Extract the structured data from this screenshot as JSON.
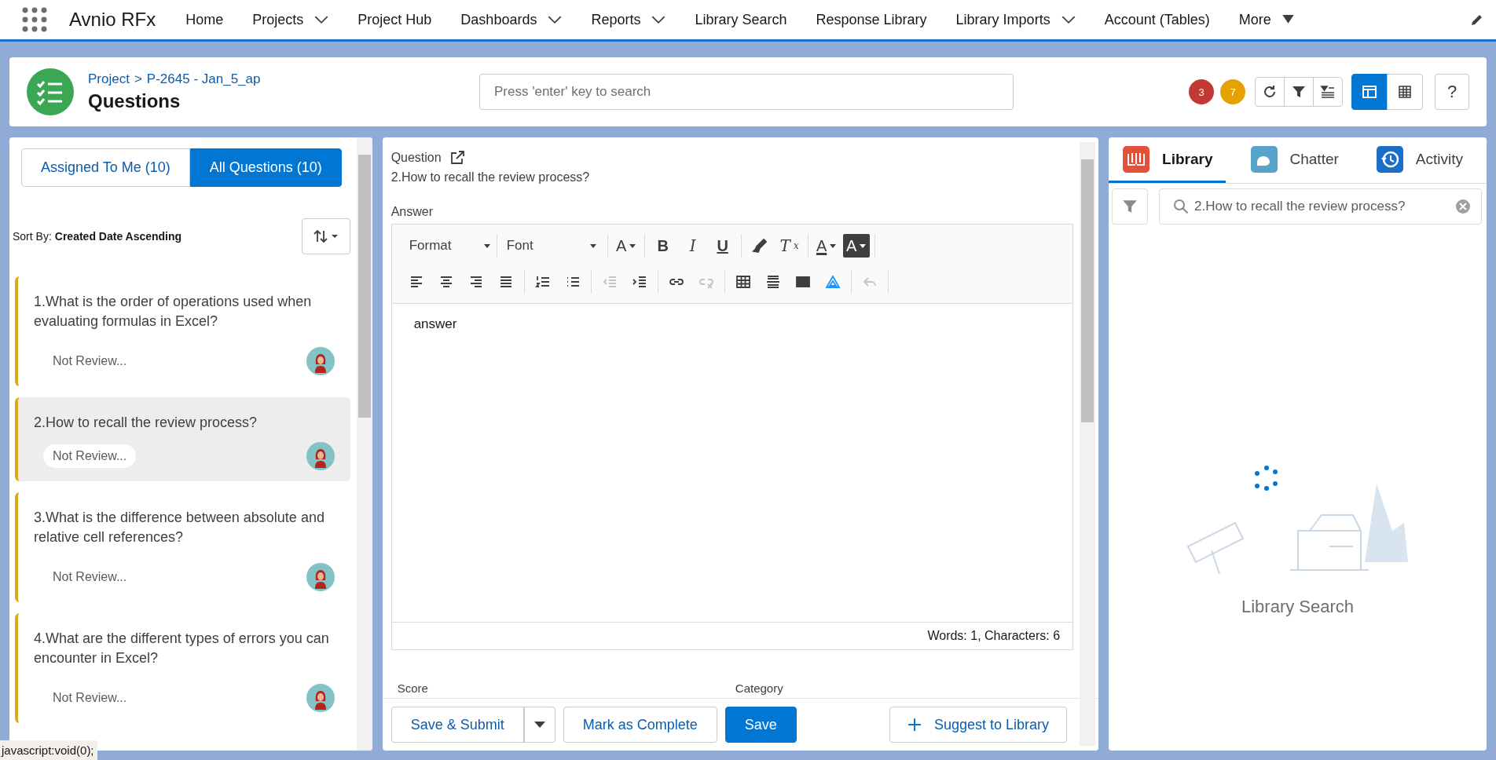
{
  "nav": {
    "app_name": "Avnio RFx",
    "items": [
      {
        "label": "Home",
        "kind": "link"
      },
      {
        "label": "Projects",
        "kind": "chevron-menu"
      },
      {
        "label": "Project Hub",
        "kind": "link"
      },
      {
        "label": "Dashboards",
        "kind": "chevron-menu"
      },
      {
        "label": "Reports",
        "kind": "chevron-menu"
      },
      {
        "label": "Library Search",
        "kind": "link"
      },
      {
        "label": "Response Library",
        "kind": "link"
      },
      {
        "label": "Library Imports",
        "kind": "chevron-menu"
      },
      {
        "label": "Account (Tables)",
        "kind": "link"
      },
      {
        "label": "More",
        "kind": "triangle-menu"
      }
    ]
  },
  "header": {
    "breadcrumb": [
      "Project",
      ">",
      "P-2645 - Jan_5_ap"
    ],
    "title": "Questions",
    "search": {
      "placeholder": "Press 'enter' key to search"
    },
    "badges": [
      {
        "count": "3",
        "color": "#c23934"
      },
      {
        "count": "7",
        "color": "#e4a201"
      }
    ],
    "views": [
      {
        "kind": "cards",
        "selected": true
      },
      {
        "kind": "table",
        "selected": false
      }
    ],
    "help": "?"
  },
  "left": {
    "tabs": [
      {
        "label": "Assigned To Me (10)",
        "selected": false
      },
      {
        "label": "All Questions (10)",
        "selected": true
      }
    ],
    "sort_label": "Sort By:",
    "sort_value": "Created Date Ascending",
    "questions": [
      {
        "text": "1.What is the order of operations used when evaluating formulas in Excel?",
        "status": "Not Review...",
        "selected": false
      },
      {
        "text": "2.How to recall the review process?",
        "status": "Not Review...",
        "selected": true
      },
      {
        "text": "3.What is the difference between absolute and relative cell references?",
        "status": "Not Review...",
        "selected": false
      },
      {
        "text": "4.What are the different types of errors you can encounter in Excel?",
        "status": "Not Review...",
        "selected": false
      }
    ]
  },
  "middle": {
    "question_label": "Question",
    "question_text": "2.How to recall the review process?",
    "answer_label": "Answer",
    "toolbar": [
      [
        [
          {
            "kind": "select",
            "label": "Format"
          },
          {
            "kind": "select",
            "label": "Font"
          }
        ],
        [
          {
            "kind": "glyph-menu",
            "glyph": "A",
            "disabled": false
          }
        ],
        [
          {
            "kind": "bold",
            "glyph": "B",
            "disabled": false
          },
          {
            "kind": "italic",
            "glyph": "I",
            "disabled": false
          },
          {
            "kind": "underline",
            "glyph": "U",
            "disabled": false
          }
        ],
        [
          {
            "kind": "brush",
            "disabled": false
          },
          {
            "kind": "clear-format",
            "glyph": "T",
            "sub": "x",
            "disabled": false
          }
        ],
        [
          {
            "kind": "text-color",
            "glyph": "A",
            "disabled": false
          },
          {
            "kind": "bg-color",
            "glyph": "A",
            "disabled": false
          }
        ]
      ],
      [
        [
          {
            "kind": "align-left",
            "disabled": false
          },
          {
            "kind": "align-center",
            "disabled": false
          },
          {
            "kind": "align-right",
            "disabled": false
          },
          {
            "kind": "justify",
            "disabled": false
          }
        ],
        [
          {
            "kind": "numbered-list",
            "disabled": false
          },
          {
            "kind": "bullet-list",
            "disabled": false
          }
        ],
        [
          {
            "kind": "outdent",
            "disabled": true
          },
          {
            "kind": "indent",
            "disabled": false
          }
        ],
        [
          {
            "kind": "link",
            "disabled": false
          },
          {
            "kind": "unlink",
            "disabled": true
          }
        ],
        [
          {
            "kind": "table",
            "disabled": false
          },
          {
            "kind": "rule",
            "disabled": false
          },
          {
            "kind": "image",
            "disabled": false
          },
          {
            "kind": "brand",
            "disabled": false
          }
        ],
        [
          {
            "kind": "undo",
            "disabled": true
          }
        ]
      ]
    ],
    "answer": "answer",
    "counter": "Words: 1, Characters: 6",
    "fields": [
      "Score",
      "Category"
    ],
    "buttons": [
      {
        "label": "Save & Submit",
        "kind": "split"
      },
      {
        "label": "Mark as Complete",
        "kind": "outline"
      },
      {
        "label": "Save",
        "kind": "primary"
      },
      {
        "label": "Suggest to Library",
        "kind": "add"
      }
    ]
  },
  "right": {
    "tabs": [
      {
        "label": "Library",
        "selected": true,
        "color": "#e3513a"
      },
      {
        "label": "Chatter",
        "selected": false,
        "color": "#56a4c9"
      },
      {
        "label": "Activity",
        "selected": false,
        "color": "#1b6fc9"
      }
    ],
    "search": {
      "value": "2.How to recall the review process?"
    },
    "caption": "Library Search"
  },
  "status_bar": "javascript:void(0);"
}
